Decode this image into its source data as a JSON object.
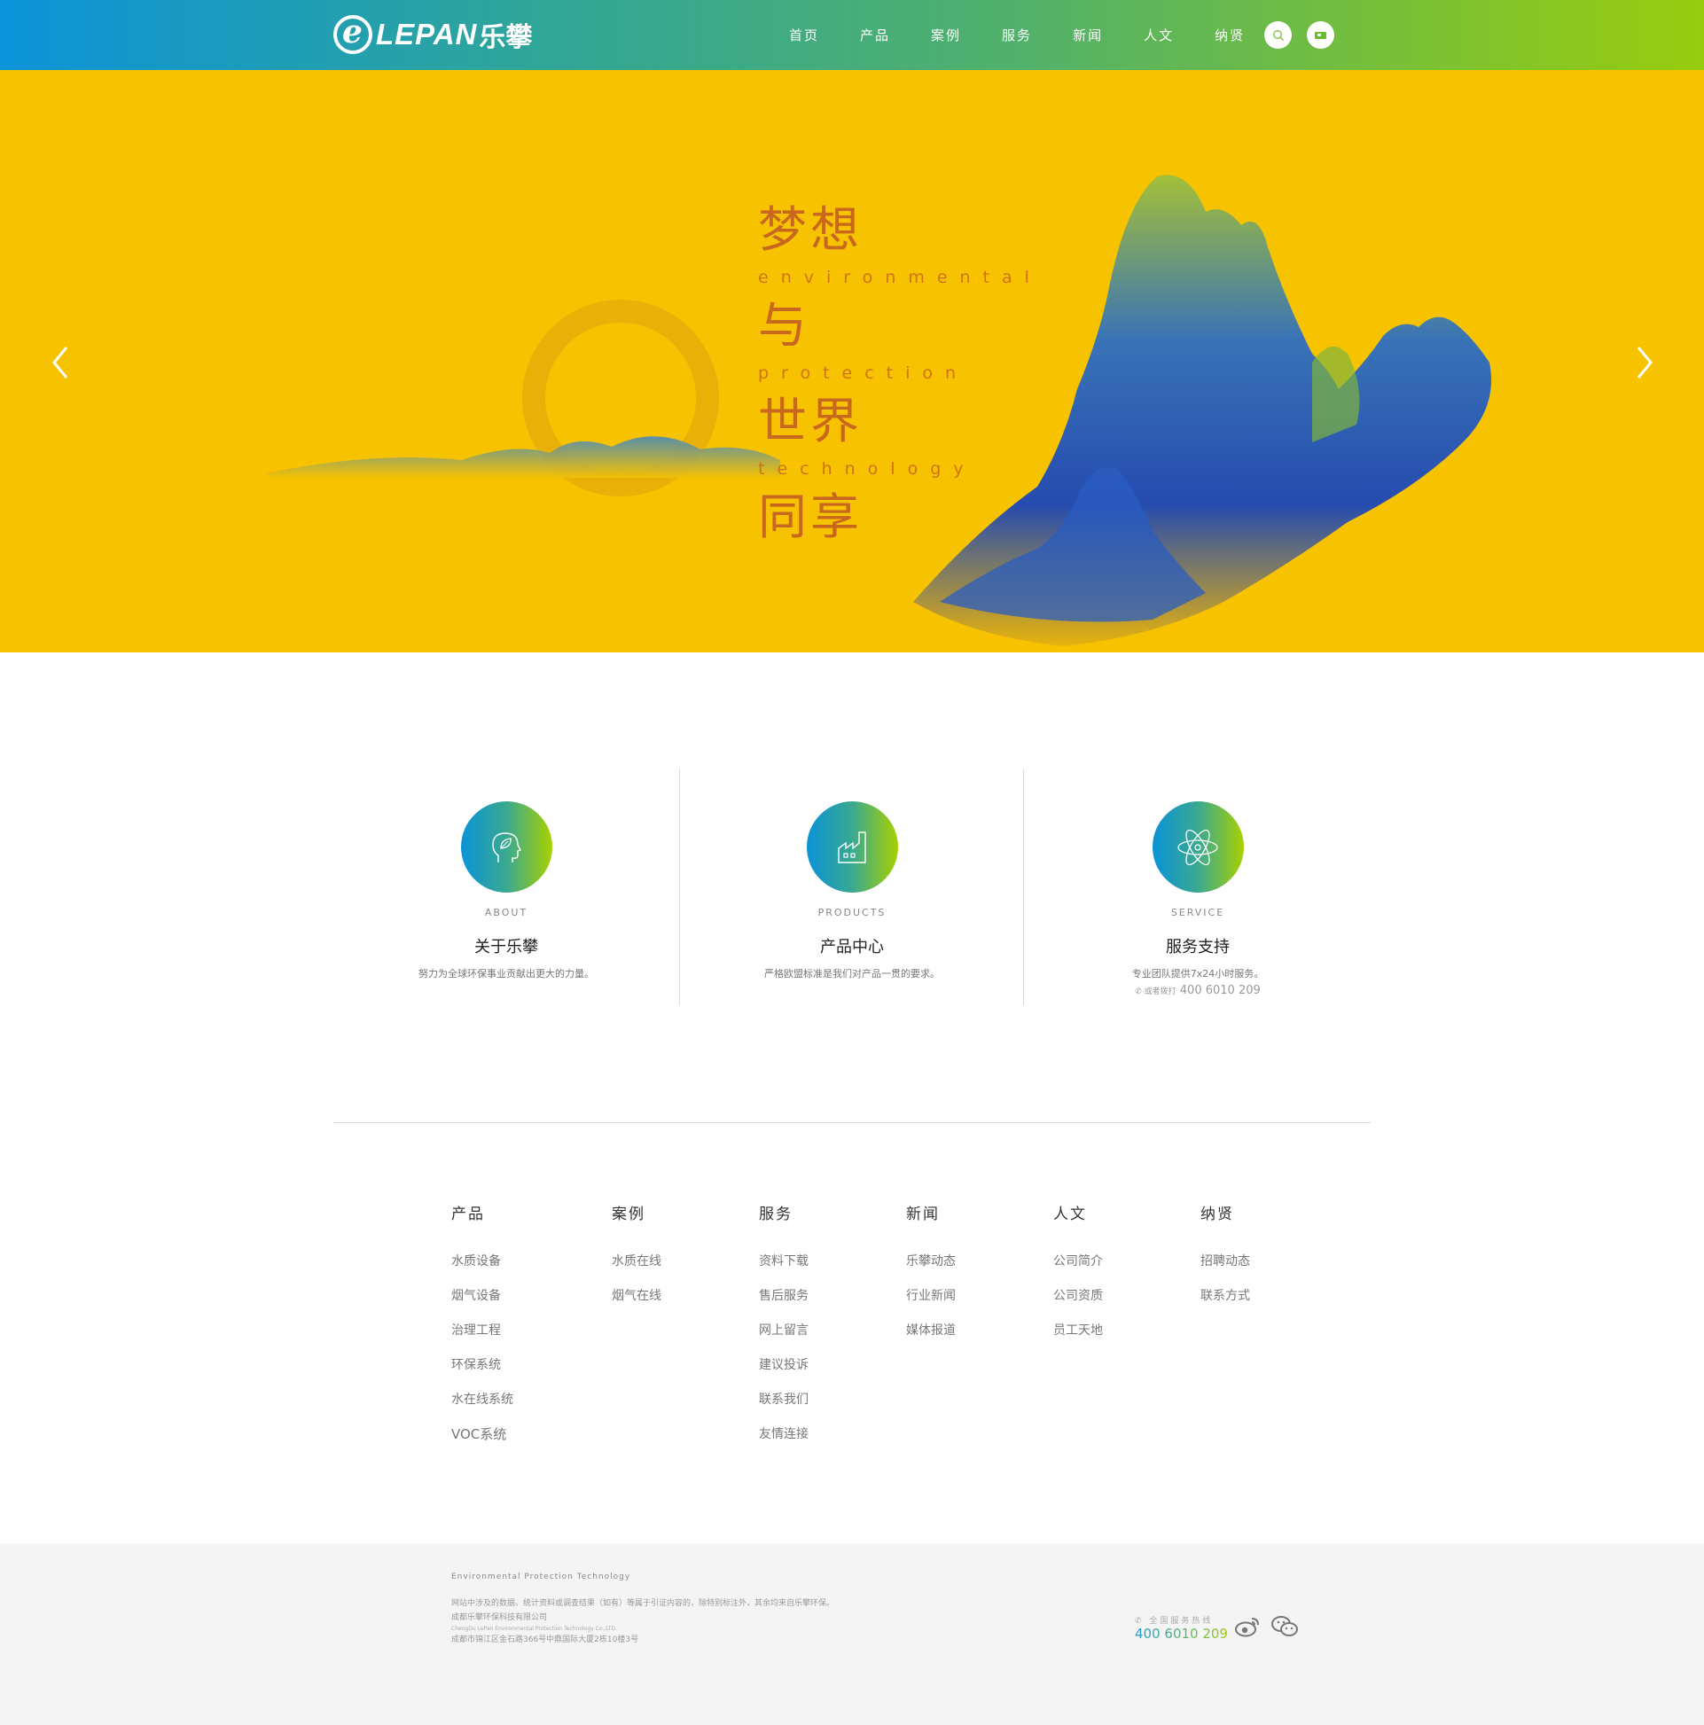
{
  "header": {
    "logo_word": "LEPAN",
    "logo_cn": "乐攀",
    "nav": [
      "首页",
      "产品",
      "案例",
      "服务",
      "新闻",
      "人文",
      "纳贤"
    ],
    "icons": {
      "search": "search-icon",
      "flag": "flag-icon"
    },
    "gradient": [
      "#0b93d9",
      "#98cc0d"
    ]
  },
  "banner": {
    "background": "#f7c300",
    "slogan": [
      {
        "cn": "梦想",
        "en": "environmental"
      },
      {
        "cn": "与",
        "en": "protection"
      },
      {
        "cn": "世界",
        "en": "technology"
      },
      {
        "cn": "同享",
        "en": ""
      }
    ],
    "text_color": "#c8671e"
  },
  "features": [
    {
      "icon": "head-leaf-icon",
      "en": "ABOUT",
      "title": "关于乐攀",
      "desc": "努力为全球环保事业贡献出更大的力量。",
      "phone_label": "",
      "phone": ""
    },
    {
      "icon": "factory-icon",
      "en": "PRODUCTS",
      "title": "产品中心",
      "desc": "严格欧盟标准是我们对产品一贯的要求。",
      "phone_label": "",
      "phone": ""
    },
    {
      "icon": "atom-icon",
      "en": "SERVICE",
      "title": "服务支持",
      "desc": "专业团队提供7x24小时服务。",
      "phone_label": "或者拨打",
      "phone": "400 6010 209"
    }
  ],
  "footer_links": [
    {
      "head": "产品",
      "items": [
        "水质设备",
        "烟气设备",
        "治理工程",
        "环保系统",
        "水在线系统",
        "VOC系统"
      ]
    },
    {
      "head": "案例",
      "items": [
        "水质在线",
        "烟气在线"
      ]
    },
    {
      "head": "服务",
      "items": [
        "资料下载",
        "售后服务",
        "网上留言",
        "建议投诉",
        "联系我们",
        "友情连接"
      ]
    },
    {
      "head": "新闻",
      "items": [
        "乐攀动态",
        "行业新闻",
        "媒体报道"
      ]
    },
    {
      "head": "人文",
      "items": [
        "公司简介",
        "公司资质",
        "员工天地"
      ]
    },
    {
      "head": "纳贤",
      "items": [
        "招聘动态",
        "联系方式"
      ]
    }
  ],
  "bottom": {
    "tagline": "Environmental  Protection  Technology",
    "notice": "网站中涉及的数据、统计资料或调查结果（如有）等属于引证内容的，除特别标注外，其余均来自乐攀环保。",
    "company": "成都乐攀环保科技有限公司",
    "company_en": "ChengDu LePan Environmental Protection Technology Co.,LTD.",
    "address": "成都市锦江区金石路366号中鼎国际大厦2栋10楼3号",
    "hotline_label": "全国服务热线",
    "hotline": "400 6010 209",
    "social": [
      "weibo-icon",
      "wechat-icon"
    ]
  }
}
